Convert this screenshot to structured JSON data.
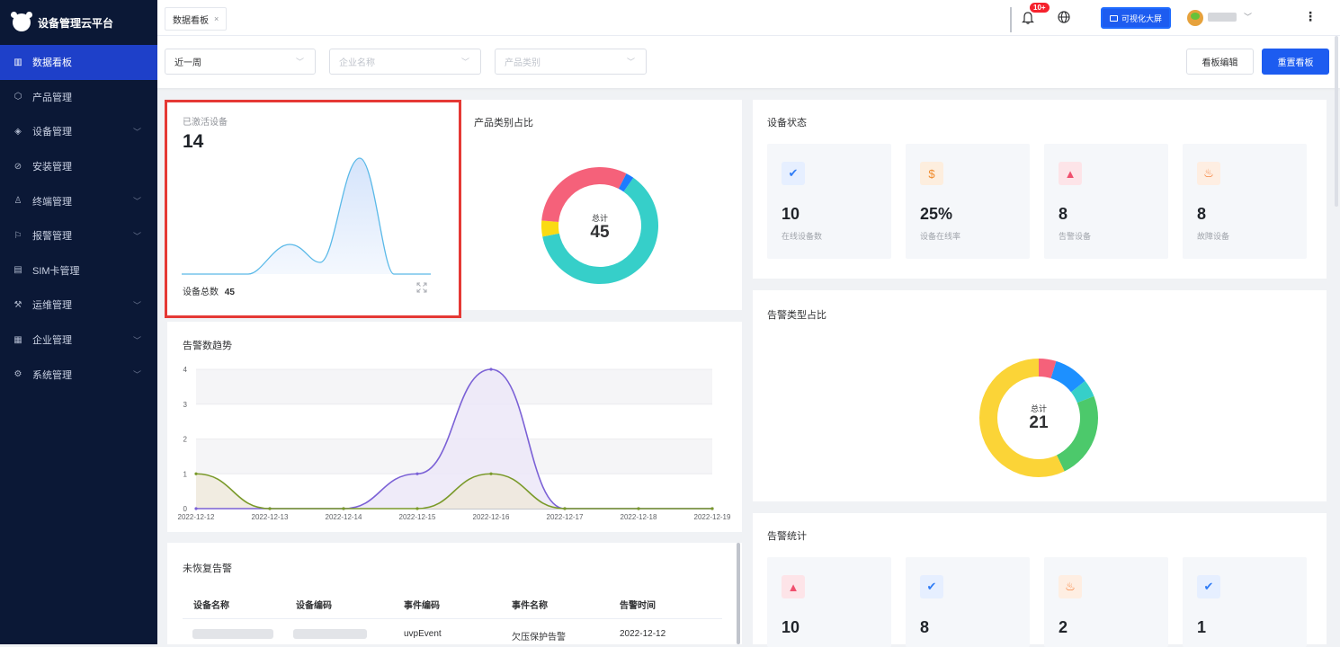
{
  "app": {
    "title": "设备管理云平台"
  },
  "sidebar": {
    "items": [
      {
        "label": "数据看板",
        "icon": "bar-chart-icon",
        "active": true,
        "expandable": false
      },
      {
        "label": "产品管理",
        "icon": "cube-icon",
        "active": false,
        "expandable": false
      },
      {
        "label": "设备管理",
        "icon": "layers-icon",
        "active": false,
        "expandable": true
      },
      {
        "label": "安装管理",
        "icon": "compass-icon",
        "active": false,
        "expandable": false
      },
      {
        "label": "终端管理",
        "icon": "user-icon",
        "active": false,
        "expandable": true
      },
      {
        "label": "报警管理",
        "icon": "alarm-icon",
        "active": false,
        "expandable": true
      },
      {
        "label": "SIM卡管理",
        "icon": "sim-card-icon",
        "active": false,
        "expandable": false
      },
      {
        "label": "运维管理",
        "icon": "wrench-icon",
        "active": false,
        "expandable": true
      },
      {
        "label": "企业管理",
        "icon": "building-icon",
        "active": false,
        "expandable": true
      },
      {
        "label": "系统管理",
        "icon": "gear-icon",
        "active": false,
        "expandable": true
      }
    ]
  },
  "topbar": {
    "tab_label": "数据看板",
    "tab_close": "×",
    "notification_badge": "10+",
    "bigscreen_label": "可视化大屏",
    "more_label": "⋮"
  },
  "filters": {
    "period": {
      "value": "近一周"
    },
    "company": {
      "placeholder": "企业名称"
    },
    "product_type": {
      "placeholder": "产品类别"
    },
    "edit_label": "看板编辑",
    "reset_label": "重置看板"
  },
  "activated": {
    "label": "已激活设备",
    "value": "14",
    "total_label": "设备总数",
    "total_value": "45"
  },
  "product_share": {
    "title": "产品类别占比",
    "center_label": "总计",
    "center_value": "45",
    "chart_data": {
      "type": "pie",
      "title": "产品类别占比",
      "slices": [
        {
          "value": 28,
          "color": "#36cfc9"
        },
        {
          "value": 2,
          "color": "#fadb14"
        },
        {
          "value": 14,
          "color": "#f5617a"
        },
        {
          "value": 1,
          "color": "#1d7bff"
        }
      ]
    }
  },
  "device_status": {
    "title": "设备状态",
    "tiles": [
      {
        "value": "10",
        "label": "在线设备数",
        "icon": "verified-icon",
        "color": "#2f7cf6",
        "bg": "#e6efff"
      },
      {
        "value": "25%",
        "label": "设备在线率",
        "icon": "money-bag-icon",
        "color": "#f08c2e",
        "bg": "#fdeede"
      },
      {
        "value": "8",
        "label": "告警设备",
        "icon": "alarm-bell-icon",
        "color": "#f0506e",
        "bg": "#fde4e8"
      },
      {
        "value": "8",
        "label": "故障设备",
        "icon": "fire-icon",
        "color": "#f5762a",
        "bg": "#feeee2"
      }
    ]
  },
  "alarm_trend": {
    "title": "告警数趋势",
    "chart_data": {
      "type": "line",
      "title": "告警数趋势",
      "x": [
        "2022-12-12",
        "2022-12-13",
        "2022-12-14",
        "2022-12-15",
        "2022-12-16",
        "2022-12-17",
        "2022-12-18",
        "2022-12-19"
      ],
      "ylim": [
        0,
        4
      ],
      "yticks": [
        "0",
        "1",
        "2",
        "3",
        "4"
      ],
      "series": [
        {
          "values": [
            0,
            0,
            0,
            1,
            4,
            0,
            0,
            0
          ],
          "color": "#7b61d6"
        },
        {
          "values": [
            1,
            0,
            0,
            0,
            1,
            0,
            0,
            0
          ],
          "color": "#7a9a2a"
        }
      ]
    }
  },
  "alarm_type": {
    "title": "告警类型占比",
    "center_label": "总计",
    "center_value": "21",
    "chart_data": {
      "type": "pie",
      "title": "告警类型占比",
      "slices": [
        {
          "value": 1,
          "color": "#f5617a"
        },
        {
          "value": 2,
          "color": "#1d90ff"
        },
        {
          "value": 1,
          "color": "#36cfc9"
        },
        {
          "value": 5,
          "color": "#4cc96b"
        },
        {
          "value": 12,
          "color": "#fbd437"
        }
      ]
    }
  },
  "unresolved": {
    "title": "未恢复告警",
    "columns": [
      "设备名称",
      "设备编码",
      "事件编码",
      "事件名称",
      "告警时间"
    ],
    "rows": [
      {
        "event_code": "uvpEvent",
        "event_name": "欠压保护告警",
        "time": "2022-12-12"
      }
    ]
  },
  "alarm_stats": {
    "title": "告警统计",
    "tiles": [
      {
        "value": "10",
        "icon": "alarm-bell-icon",
        "color": "#f0506e",
        "bg": "#fde4e8"
      },
      {
        "value": "8",
        "icon": "verified-icon",
        "color": "#2f7cf6",
        "bg": "#e6efff"
      },
      {
        "value": "2",
        "icon": "fire-icon",
        "color": "#f5762a",
        "bg": "#feeee2"
      },
      {
        "value": "1",
        "icon": "verified-icon",
        "color": "#2f7cf6",
        "bg": "#e6efff"
      }
    ]
  }
}
